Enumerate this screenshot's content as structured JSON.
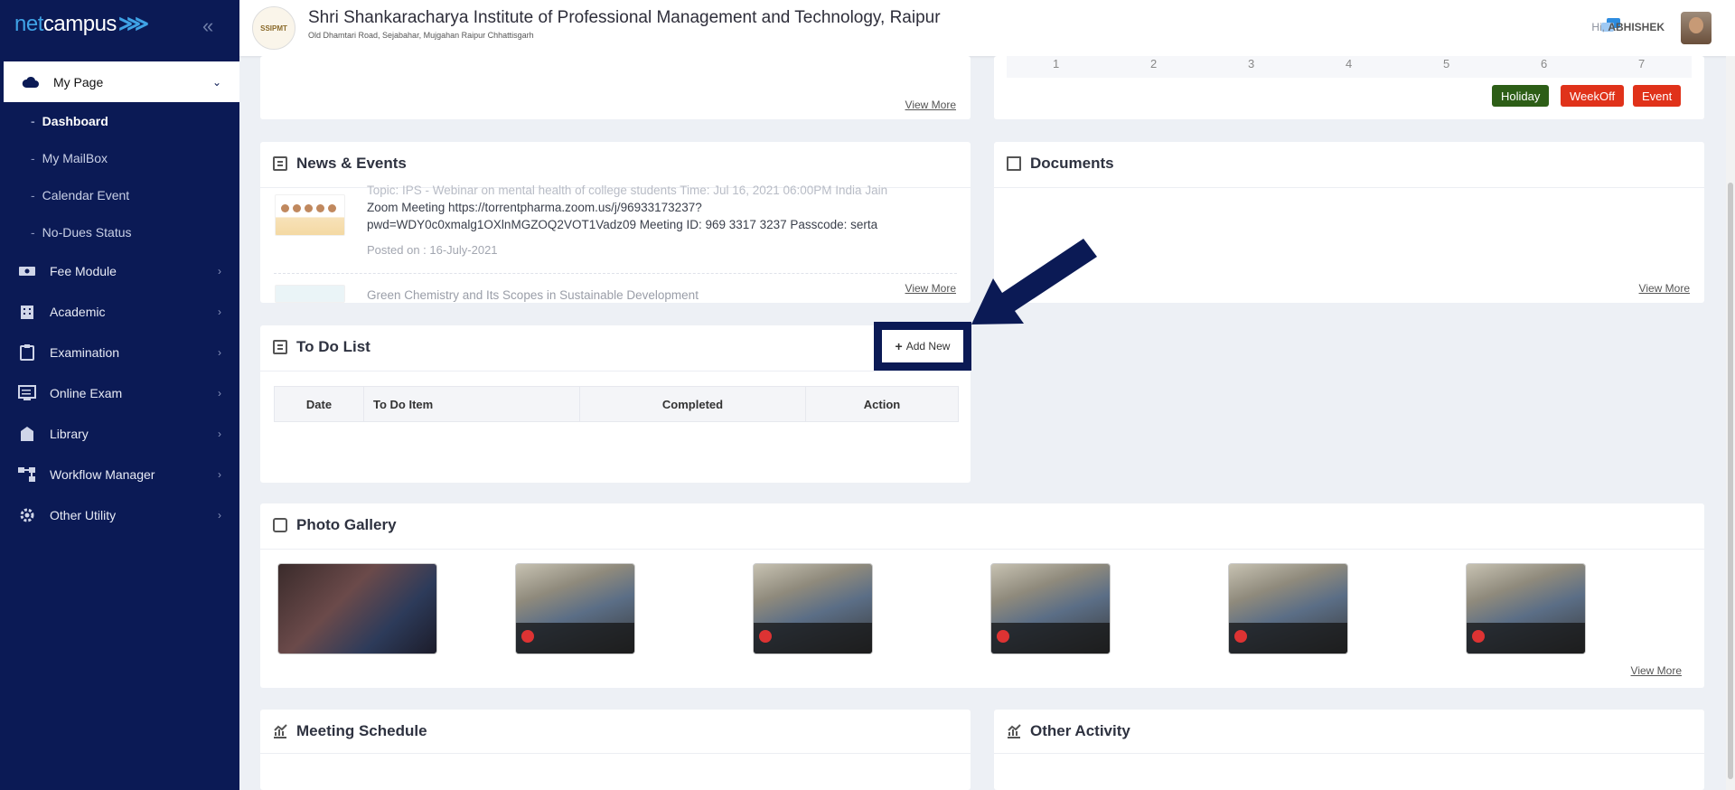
{
  "sidebar": {
    "logo_part1": "net",
    "logo_part2": "campus",
    "collapse_icon": "chevrons-left-icon",
    "items": [
      {
        "label": "My Page",
        "icon": "cloud-icon",
        "expanded": true,
        "subitems": [
          "Dashboard",
          "My MailBox",
          "Calendar Event",
          "No-Dues Status"
        ]
      },
      {
        "label": "Fee Module",
        "icon": "money-icon"
      },
      {
        "label": "Academic",
        "icon": "building-icon"
      },
      {
        "label": "Examination",
        "icon": "clipboard-icon"
      },
      {
        "label": "Online Exam",
        "icon": "monitor-icon"
      },
      {
        "label": "Library",
        "icon": "library-icon"
      },
      {
        "label": "Workflow Manager",
        "icon": "workflow-icon"
      },
      {
        "label": "Other Utility",
        "icon": "gear-icon"
      }
    ]
  },
  "header": {
    "logo_text": "SSIPMT",
    "institute_name": "Shri Shankaracharya Institute of Professional Management and Technology, Raipur",
    "address": "Old Dhamtari Road, Sejabahar, Mujgahan Raipur Chhattisgarh",
    "greeting": "Hi,",
    "user": "ABHISHEK"
  },
  "top_left_card": {
    "view_more": "View More"
  },
  "calendar_card": {
    "numbers": [
      "1",
      "2",
      "3",
      "4",
      "5",
      "6",
      "7"
    ],
    "legend": [
      {
        "label": "Holiday",
        "color": "#2d5e17"
      },
      {
        "label": "WeekOff",
        "color": "#e0321a"
      },
      {
        "label": "Event",
        "color": "#e0321a"
      }
    ]
  },
  "news": {
    "title": "News & Events",
    "item1_line0": "Topic: IPS - Webinar on mental health of college students Time: Jul 16, 2021 06:00PM India Jain",
    "item1_line1": "Zoom Meeting https://torrentpharma.zoom.us/j/96933173237?",
    "item1_line2": "pwd=WDY0c0xmalg1OXlnMGZOQ2VOT1Vadz09 Meeting ID: 969 3317 3237 Passcode: serta",
    "item1_posted": "Posted on : 16-July-2021",
    "item2_title": "Green Chemistry and Its Scopes in Sustainable Development",
    "view_more": "View More"
  },
  "documents": {
    "title": "Documents",
    "view_more": "View More"
  },
  "todo": {
    "title": "To Do List",
    "add_label": "Add New",
    "columns": [
      "Date",
      "To Do Item",
      "Completed",
      "Action"
    ]
  },
  "gallery": {
    "title": "Photo Gallery",
    "view_more": "View More",
    "count": 6
  },
  "meeting": {
    "title": "Meeting Schedule"
  },
  "other_activity": {
    "title": "Other Activity"
  }
}
